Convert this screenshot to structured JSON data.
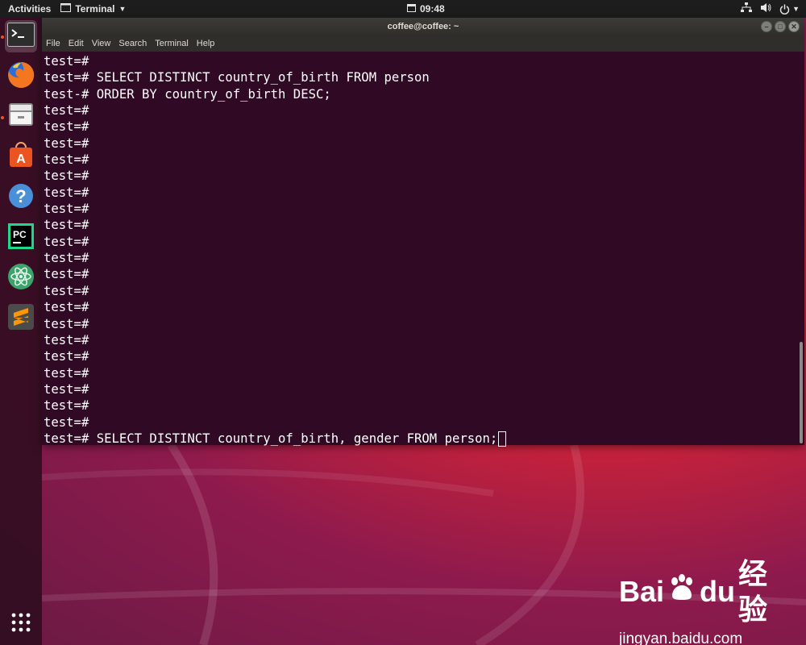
{
  "topbar": {
    "activities": "Activities",
    "app_name": "Terminal",
    "time": "09:48",
    "icons": [
      "network-icon",
      "volume-icon",
      "power-icon"
    ]
  },
  "dock": {
    "items": [
      "terminal-icon",
      "firefox-icon",
      "files-icon",
      "software-center-icon",
      "help-icon",
      "pycharm-icon",
      "atom-icon",
      "sublime-text-icon"
    ],
    "show_apps": "show-applications-icon"
  },
  "window": {
    "title": "coffee@coffee: ~",
    "menu": [
      "File",
      "Edit",
      "View",
      "Search",
      "Terminal",
      "Help"
    ]
  },
  "terminal": {
    "lines": [
      "test=#",
      "test=# SELECT DISTINCT country_of_birth FROM person",
      "test-# ORDER BY country_of_birth DESC;",
      "test=#",
      "test=#",
      "test=#",
      "test=#",
      "test=#",
      "test=#",
      "test=#",
      "test=#",
      "test=#",
      "test=#",
      "test=#",
      "test=#",
      "test=#",
      "test=#",
      "test=#",
      "test=#",
      "test=#",
      "test=#",
      "test=#",
      "test=#"
    ],
    "current_line": "test=# SELECT DISTINCT country_of_birth, gender FROM person;"
  },
  "watermark": {
    "logo_text": "Bai",
    "logo_text2": "du",
    "logo_cn": "经验",
    "url": "jingyan.baidu.com"
  }
}
